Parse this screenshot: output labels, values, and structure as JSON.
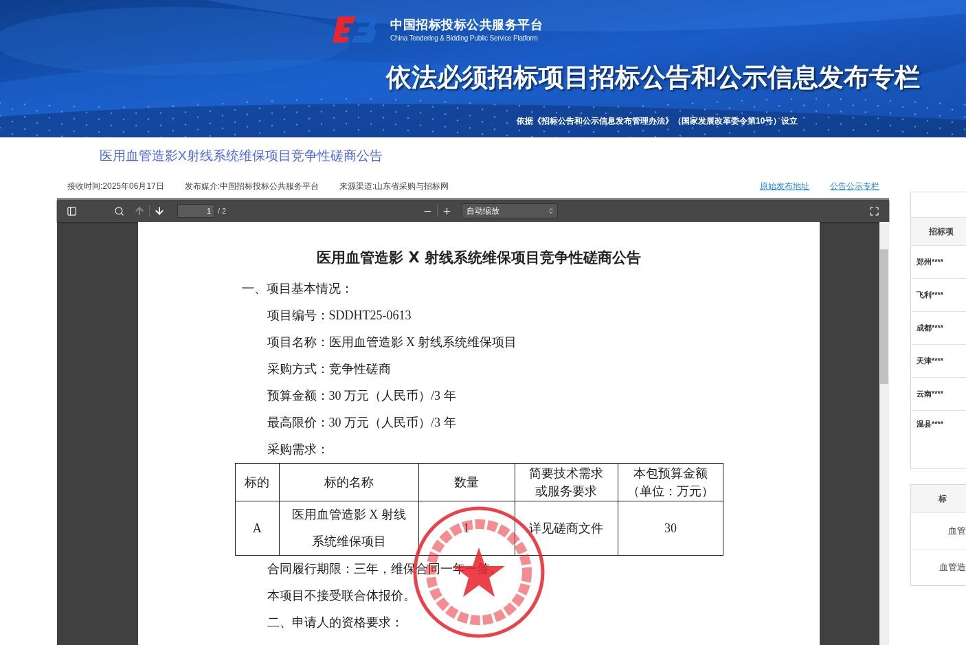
{
  "banner": {
    "platform_name": "中国招标投标公共服务平台",
    "platform_name_en": "China Tendering & Bidding Public Service Platform",
    "headline": "依法必须招标项目招标公告和公示信息发布专栏",
    "basis": "依据《招标公告和公示信息发布管理办法》（国家发展改革委令第10号）设立"
  },
  "notice_title": "医用血管造影X射线系统维保项目竞争性磋商公告",
  "meta": [
    "接收时间:2025年06月17日",
    "发布媒介:中国招标投标公共服务平台",
    "来源渠道:山东省采购与招标网"
  ],
  "links": [
    "原始发布地址",
    "公告公示专栏"
  ],
  "viewer": {
    "page_number": "1",
    "page_count": "/ 2",
    "zoom": "自动缩放"
  },
  "document": {
    "title": "医用血管造影 X 射线系统维保项目竞争性磋商公告",
    "blocks": [
      {
        "kind": "heading",
        "text": "一、项目基本情况："
      },
      {
        "kind": "line",
        "text": "项目编号：SDDHT25-0613"
      },
      {
        "kind": "line",
        "text": "项目名称：医用血管造影 X 射线系统维保项目"
      },
      {
        "kind": "line",
        "text": "采购方式：竞争性磋商"
      },
      {
        "kind": "line",
        "text": "预算金额：30 万元（人民币）/3 年"
      },
      {
        "kind": "line",
        "text": "最高限价：30 万元（人民币）/3 年"
      },
      {
        "kind": "line",
        "text": "采购需求："
      },
      {
        "kind": "table",
        "columns": [
          "标的",
          "标的名称",
          "数量",
          "简要技术需求或服务要求",
          "本包预算金额（单位：万元）"
        ],
        "rows": [
          [
            "A",
            "医用血管造影 X 射线系统维保项目",
            "1",
            "详见磋商文件",
            "30"
          ]
        ]
      },
      {
        "kind": "line",
        "text": "合同履行期限：三年，维保合同一年一签。"
      },
      {
        "kind": "line",
        "text": "本项目不接受联合体报价。"
      },
      {
        "kind": "line",
        "text": "二、申请人的资格要求："
      }
    ]
  },
  "sidebar": [
    {
      "header": "招标项",
      "rows": [
        "郑州****",
        "飞利****",
        "成都****",
        "天津****",
        "云南****",
        "温县****"
      ]
    },
    {
      "header": "标",
      "rows": [
        "血管",
        "血管造"
      ]
    }
  ]
}
